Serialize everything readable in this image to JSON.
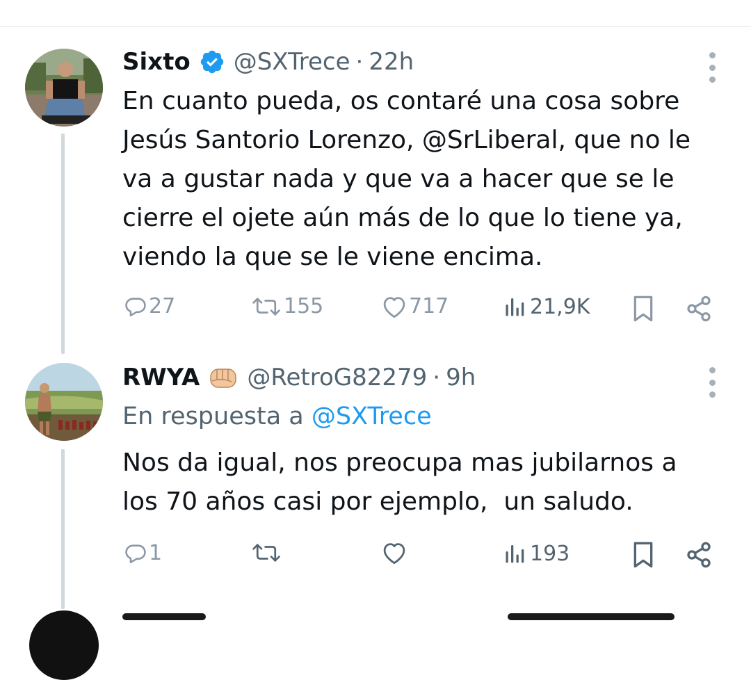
{
  "tweets": [
    {
      "name": "Sixto",
      "verified": true,
      "handle": "@SXTrece",
      "sep": "·",
      "time": "22h",
      "text_lines": [
        "En cuanto pueda, os contaré una cosa sobre",
        "Jesús Santorio Lorenzo, @SrLiberal, que no le",
        "va a gustar nada y que va a hacer que se le",
        "cierre el ojete aún más de lo que lo tiene ya,",
        "viendo la que se le viene encima."
      ],
      "replies": "27",
      "retweets": "155",
      "likes": "717",
      "views": "21,9K"
    },
    {
      "name": "RWYA",
      "emoji_icon": "oncoming-fist-icon",
      "handle": "@RetroG82279",
      "sep": "·",
      "time": "9h",
      "reply_prefix": "En respuesta a",
      "reply_mention": "@SXTrece",
      "text_lines": [
        "Nos da igual, nos preocupa mas jubilarnos a",
        "los 70 años casi por ejemplo,  un saludo."
      ],
      "replies": "1",
      "retweets": "",
      "likes": "",
      "views": "193"
    }
  ],
  "colors": {
    "text": "#0f1419",
    "secondary": "#536471",
    "muted_icon": "#8b98a5",
    "link": "#1d9bf0",
    "verified": "#1d9bf0",
    "thread_line": "#cfd9de"
  },
  "icons": [
    "verified-badge-icon",
    "more-icon",
    "reply-icon",
    "retweet-icon",
    "like-icon",
    "views-icon",
    "bookmark-icon",
    "share-icon"
  ]
}
